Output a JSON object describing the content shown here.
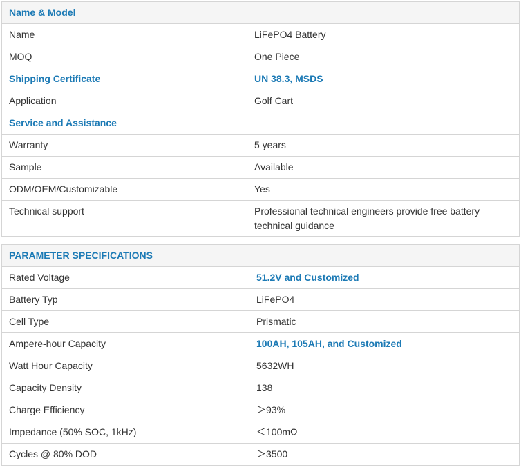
{
  "table1": {
    "header": "Name & Model",
    "rows": [
      {
        "label": "Name",
        "value": "LiFePO4 Battery"
      },
      {
        "label": "MOQ",
        "value": "One Piece"
      },
      {
        "label": "Shipping Certificate",
        "value": "UN 38.3, MSDS"
      },
      {
        "label": "Application",
        "value": "Golf Cart"
      }
    ],
    "section2": "Service and Assistance",
    "rows2": [
      {
        "label": "Warranty",
        "value": "5 years"
      },
      {
        "label": "Sample",
        "value": "Available"
      },
      {
        "label": "ODM/OEM/Customizable",
        "value": "Yes"
      },
      {
        "label": "Technical support",
        "value": "Professional technical engineers provide free battery technical guidance"
      }
    ]
  },
  "table2": {
    "header": "PARAMETER SPECIFICATIONS",
    "rows": [
      {
        "label": "Rated Voltage",
        "value": "51.2V and Customized"
      },
      {
        "label": "Battery Typ",
        "value": "LiFePO4"
      },
      {
        "label": "Cell Type",
        "value": "Prismatic"
      },
      {
        "label": "Ampere-hour Capacity",
        "value": "100AH, 105AH, and Customized"
      },
      {
        "label": "Watt Hour Capacity",
        "value": "5632WH"
      },
      {
        "label": "Capacity Density",
        "value": "138"
      },
      {
        "label": "Charge Efficiency",
        "value": "＞93%"
      },
      {
        "label": "Impedance (50% SOC, 1kHz)",
        "value": "＜100mΩ"
      },
      {
        "label": "Cycles @ 80% DOD",
        "value": "＞3500"
      }
    ]
  }
}
